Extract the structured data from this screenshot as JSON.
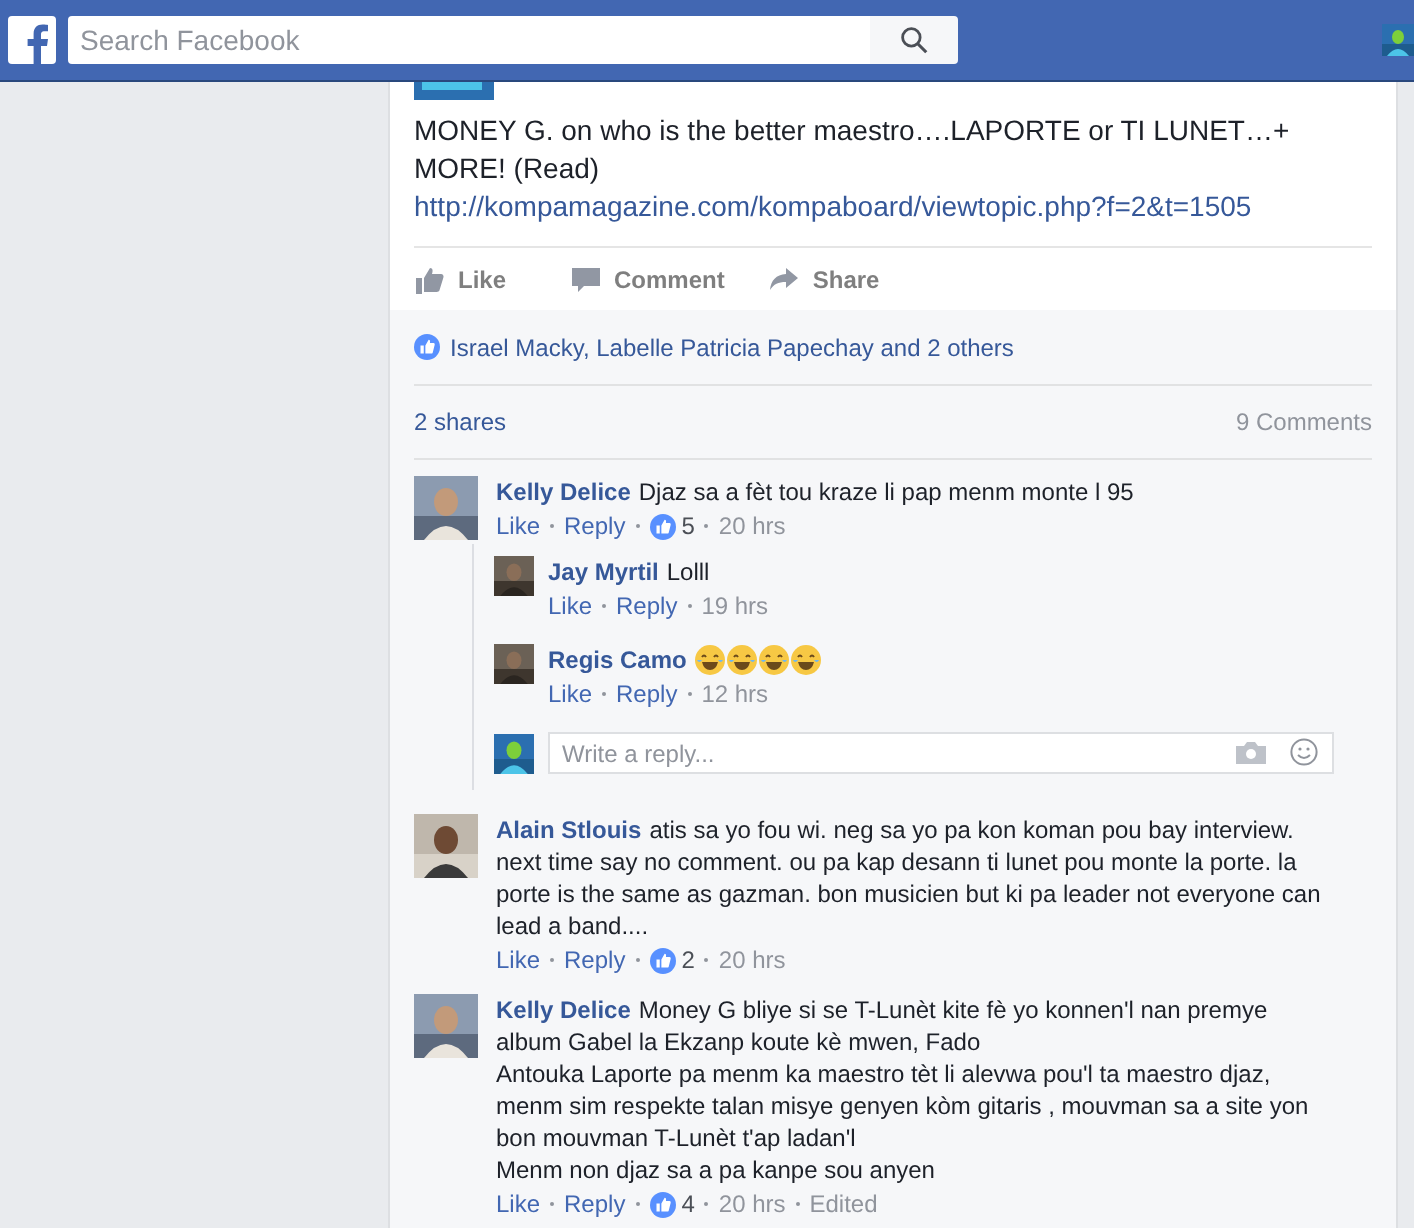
{
  "topbar": {
    "search": {
      "placeholder": "Search Facebook"
    }
  },
  "post": {
    "text": "MONEY G. on who is the better maestro….LAPORTE or TI LUNET…+ MORE! (Read)",
    "link": "http://kompamagazine.com/kompaboard/viewtopic.php?f=2&t=1505",
    "actions": [
      {
        "kind": "like",
        "label": "Like"
      },
      {
        "kind": "comment",
        "label": "Comment"
      },
      {
        "kind": "share",
        "label": "Share"
      }
    ],
    "likes": "Israel Macky, Labelle Patricia Papechay and 2 others",
    "shares": "2 shares",
    "comments_count": "9 Comments"
  },
  "comments": [
    {
      "name": "Kelly Delice",
      "lines": [
        "Djaz sa a fèt tou kraze li pap menm monte l 95"
      ],
      "like": "Like",
      "reply": "Reply",
      "likes": "5",
      "time": "20 hrs",
      "replies": [
        {
          "name": "Jay Myrtil",
          "text": "Lolll",
          "like": "Like",
          "reply": "Reply",
          "time": "19 hrs"
        },
        {
          "name": "Regis Camo",
          "reactions": [
            {
              "kind": "tears-of-joy"
            },
            {
              "kind": "tears-of-joy"
            },
            {
              "kind": "tears-of-joy"
            },
            {
              "kind": "tears-of-joy"
            }
          ],
          "like": "Like",
          "reply": "Reply",
          "time": "12 hrs"
        }
      ],
      "reply_box": {
        "placeholder": "Write a reply..."
      }
    },
    {
      "name": "Alain Stlouis",
      "lines": [
        "atis sa yo fou wi. neg sa yo pa kon koman pou bay interview. next time say no comment. ou pa kap desann ti lunet pou monte la porte. la porte is the same as gazman. bon musicien but ki pa leader not everyone can lead a band...."
      ],
      "like": "Like",
      "reply": "Reply",
      "likes": "2",
      "time": "20 hrs"
    },
    {
      "name": "Kelly Delice",
      "lines": [
        "Money G bliye si se T-Lunèt kite fè yo konnen'l nan premye album Gabel la Ekzanp koute kè mwen, Fado",
        "Antouka Laporte pa menm ka maestro tèt li alevwa pou'l ta maestro djaz, menm sim respekte talan misye genyen kòm gitaris , mouvman sa a site yon bon mouvman T-Lunèt t'ap ladan'l",
        "Menm non djaz sa a pa kanpe sou anyen"
      ],
      "like": "Like",
      "reply": "Reply",
      "likes": "4",
      "time": "20 hrs",
      "edited": "Edited"
    }
  ]
}
